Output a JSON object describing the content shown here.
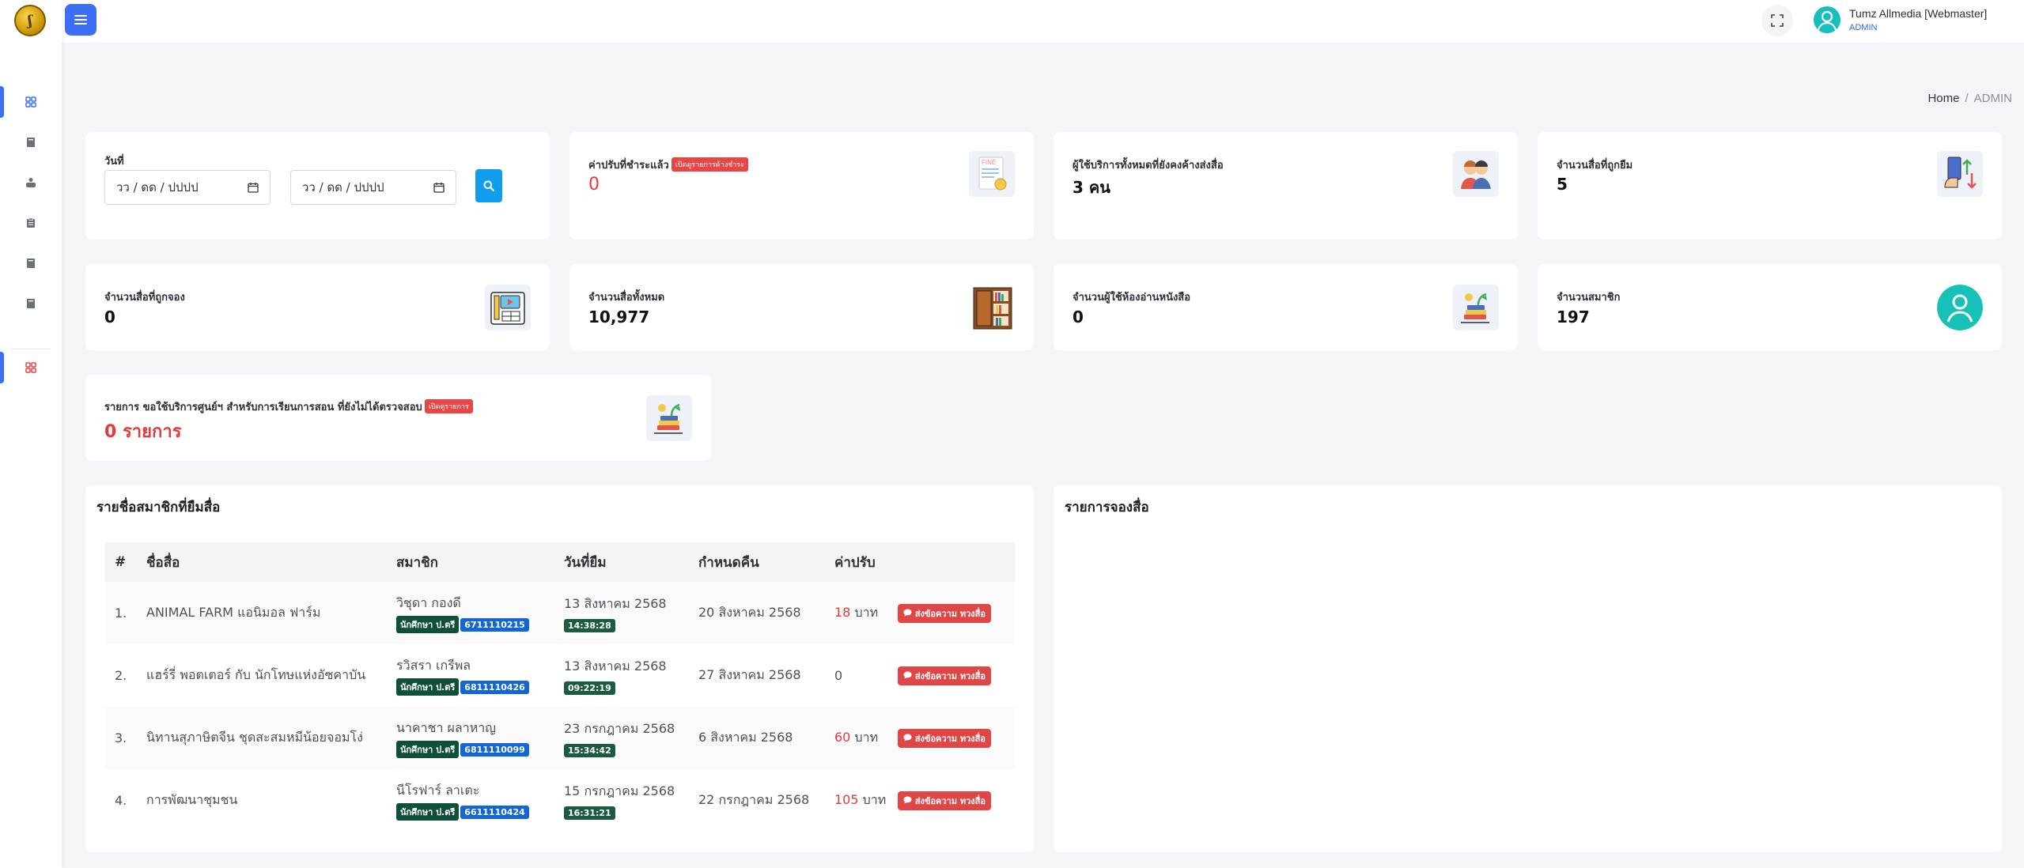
{
  "brand": {
    "logo_glyph": "ʃ",
    "accent": "#3d6ef7"
  },
  "topbar": {
    "user_name": "Tumz Allmedia [Webmaster]",
    "user_role": "ADMIN"
  },
  "breadcrumb": {
    "home": "Home",
    "separator": "/",
    "current": "ADMIN"
  },
  "date_filter": {
    "label": "วันที่",
    "start_placeholder": "วว / ดด / ปปปป",
    "end_placeholder": "วว / ดด / ปปปป"
  },
  "stats": {
    "fines_paid": {
      "label": "ค่าปรับที่ชำระแล้ว",
      "badge": "เปิดดูรายการค้างชำระ",
      "value": "0"
    },
    "users_overdue": {
      "label": "ผู้ใช้บริการทั้งหมดที่ยังคงค้างส่งสื่อ",
      "value": "3 คน"
    },
    "media_borrowed": {
      "label": "จำนวนสื่อที่ถูกยืม",
      "value": "5"
    },
    "media_reserved": {
      "label": "จำนวนสื่อที่ถูกจอง",
      "value": "0"
    },
    "media_total": {
      "label": "จำนวนสื่อทั้งหมด",
      "value": "10,977"
    },
    "reading_room_users": {
      "label": "จำนวนผู้ใช้ห้องอ่านหนังสือ",
      "value": "0"
    },
    "members": {
      "label": "จำนวนสมาชิก",
      "value": "197"
    },
    "requests_pending": {
      "label": "รายการ ขอใช้บริการศูนย์ฯ สำหรับการเรียนการสอน ที่ยังไม่ได้ตรวจสอบ",
      "badge": "เปิดดูรายการ",
      "value": "0 รายการ"
    }
  },
  "borrowers": {
    "title": "รายชื่อสมาชิกที่ยืมสื่อ",
    "headers": [
      "#",
      "ชื่อสื่อ",
      "สมาชิก",
      "วันที่ยืม",
      "กำหนดคืน",
      "ค่าปรับ"
    ],
    "rows": [
      {
        "no": "1.",
        "title": "ANIMAL FARM แอนิมอล ฟาร์ม",
        "member": "วิชุดา กองดี",
        "member_type": "นักศึกษา ป.ตรี",
        "member_id": "6711110215",
        "borrow_date": "13 สิงหาคม 2568",
        "borrow_time": "14:38:28",
        "due_date": "20 สิงหาคม 2568",
        "fine": "18",
        "fine_unit": "บาท",
        "action": "ส่งข้อความ ทวงสื่อ"
      },
      {
        "no": "2.",
        "title": "แฮร์รี่ พอตเตอร์ กับ นักโทษแห่งอัซคาบัน",
        "member": "รวิสรา เกรีพล",
        "member_type": "นักศึกษา ป.ตรี",
        "member_id": "6811110426",
        "borrow_date": "13 สิงหาคม 2568",
        "borrow_time": "09:22:19",
        "due_date": "27 สิงหาคม 2568",
        "fine": "0",
        "fine_unit": "",
        "action": "ส่งข้อความ ทวงสื่อ"
      },
      {
        "no": "3.",
        "title": "นิทานสุภาษิตจีน ชุดสะสมหมีน้อยจอมโง่",
        "member": "นาคาชา ผลาหาญ",
        "member_type": "นักศึกษา ป.ตรี",
        "member_id": "6811110099",
        "borrow_date": "23 กรกฎาคม 2568",
        "borrow_time": "15:34:42",
        "due_date": "6 สิงหาคม 2568",
        "fine": "60",
        "fine_unit": "บาท",
        "action": "ส่งข้อความ ทวงสื่อ"
      },
      {
        "no": "4.",
        "title": "การพัฒนาชุมชน",
        "member": "นีโรฟาร์ ลาเตะ",
        "member_type": "นักศึกษา ป.ตรี",
        "member_id": "6611110424",
        "borrow_date": "15 กรกฎาคม 2568",
        "borrow_time": "16:31:21",
        "due_date": "22 กรกฎาคม 2568",
        "fine": "105",
        "fine_unit": "บาท",
        "action": "ส่งข้อความ ทวงสื่อ"
      }
    ]
  },
  "reservations": {
    "title": "รายการจองสื่อ"
  }
}
